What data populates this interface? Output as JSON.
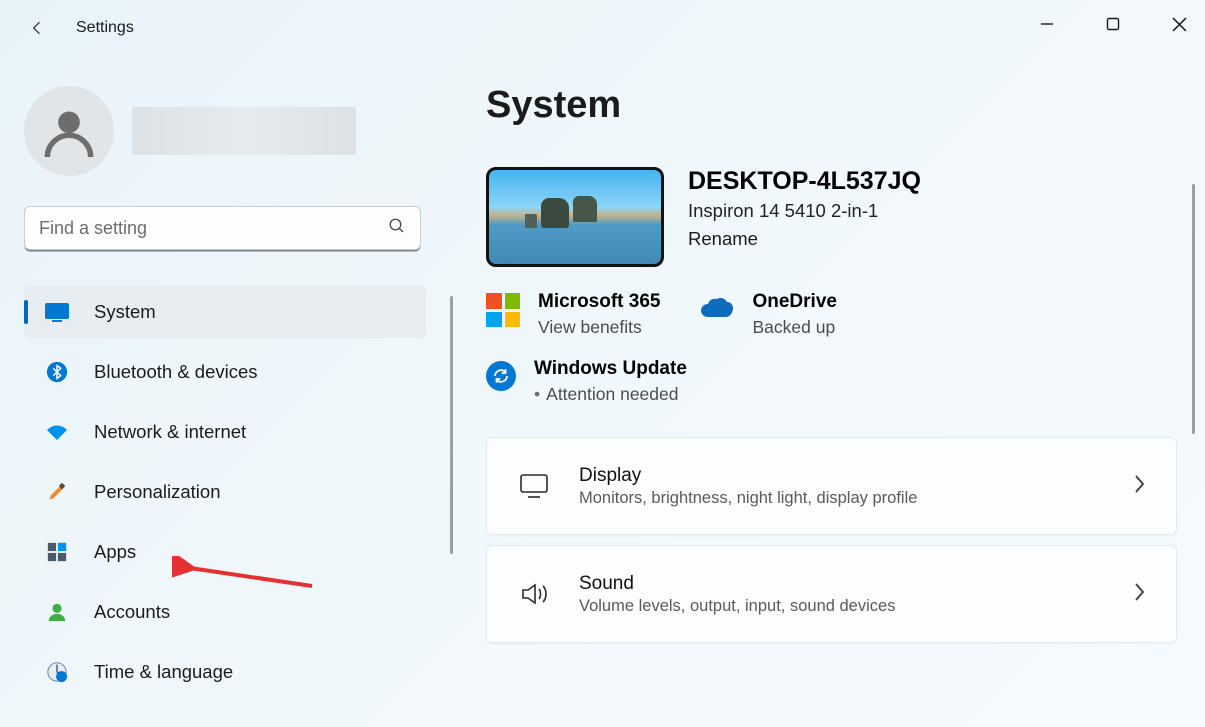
{
  "app": {
    "title": "Settings"
  },
  "search": {
    "placeholder": "Find a setting"
  },
  "sidebar": {
    "items": [
      {
        "label": "System"
      },
      {
        "label": "Bluetooth & devices"
      },
      {
        "label": "Network & internet"
      },
      {
        "label": "Personalization"
      },
      {
        "label": "Apps"
      },
      {
        "label": "Accounts"
      },
      {
        "label": "Time & language"
      }
    ]
  },
  "page": {
    "title": "System"
  },
  "device": {
    "name": "DESKTOP-4L537JQ",
    "model": "Inspiron 14 5410 2-in-1",
    "rename": "Rename"
  },
  "status": {
    "m365": {
      "title": "Microsoft 365",
      "sub": "View benefits"
    },
    "onedrive": {
      "title": "OneDrive",
      "sub": "Backed up"
    },
    "update": {
      "title": "Windows Update",
      "sub": "Attention needed"
    }
  },
  "settings": [
    {
      "title": "Display",
      "sub": "Monitors, brightness, night light, display profile"
    },
    {
      "title": "Sound",
      "sub": "Volume levels, output, input, sound devices"
    }
  ]
}
